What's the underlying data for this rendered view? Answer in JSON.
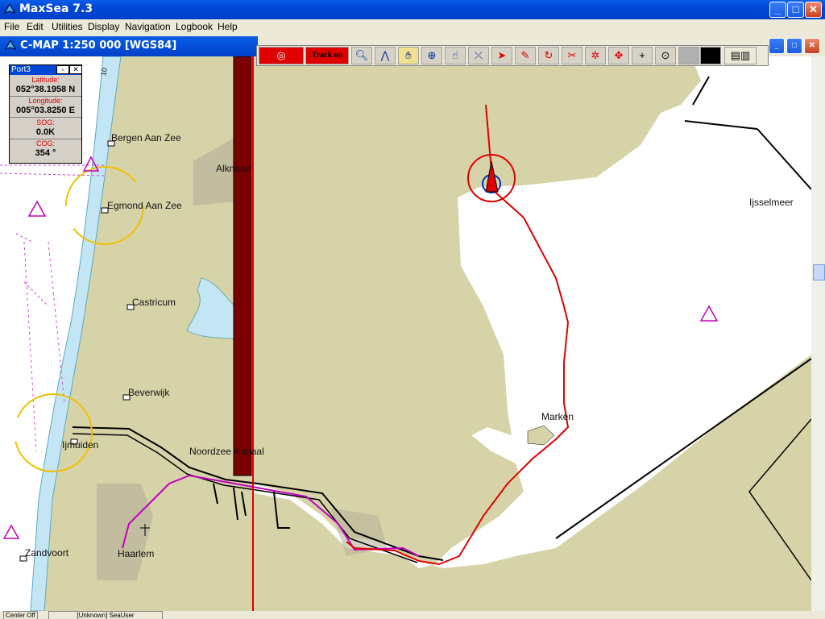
{
  "app": {
    "title": "MaxSea 7.3"
  },
  "window_controls": {
    "minimize": "_",
    "maximize": "□",
    "close": "✕"
  },
  "menu": [
    "File",
    "Edit",
    "Utilities",
    "Display",
    "Navigation",
    "Logbook",
    "Help"
  ],
  "chart_window": {
    "title": "C-MAP  1:250 000 [WGS84]"
  },
  "toolbar": {
    "track_label": "Track on",
    "tools": [
      "zoom-icon",
      "compass-icon",
      "hand-icon",
      "crosshair-icon",
      "hand-pointer-icon",
      "route-icon",
      "cursor-icon",
      "pencil-icon",
      "rotate-icon",
      "scissors-icon",
      "waypoint-icon",
      "move-icon",
      "plus-icon",
      "target-icon"
    ]
  },
  "port_panel": {
    "title": "Port3",
    "latitude_label": "Latitude:",
    "latitude": "052°38.1958 N",
    "longitude_label": "Longitude:",
    "longitude": "005°03.8250 E",
    "sog_label": "SOG:",
    "sog": "0.0K",
    "cog_label": "COG:",
    "cog": "354 °"
  },
  "map_labels": {
    "bergen": "Bergen Aan Zee",
    "alkmaar": "Alkmaar",
    "egmond": "Egmond Aan Zee",
    "castricum": "Castricum",
    "beverwijk": "Beverwijk",
    "ijmuiden": "Ijmuiden",
    "noordzee": "Noordzee Kanaal",
    "haarlem": "Haarlem",
    "zandvoort": "Zandvoort",
    "marken": "Marken",
    "ijsselmeer": "Ijsselmeer",
    "depth_marker": "10"
  },
  "statusbar": {
    "center": "Center Off",
    "user": "[Unknown] SeaUser"
  },
  "colors": {
    "land": "#d7d3a8",
    "water": "#ffffff",
    "shallow": "#c4e6f4",
    "track": "#e00000",
    "route": "#c000c0",
    "cursor_bar": "#7b0000"
  }
}
